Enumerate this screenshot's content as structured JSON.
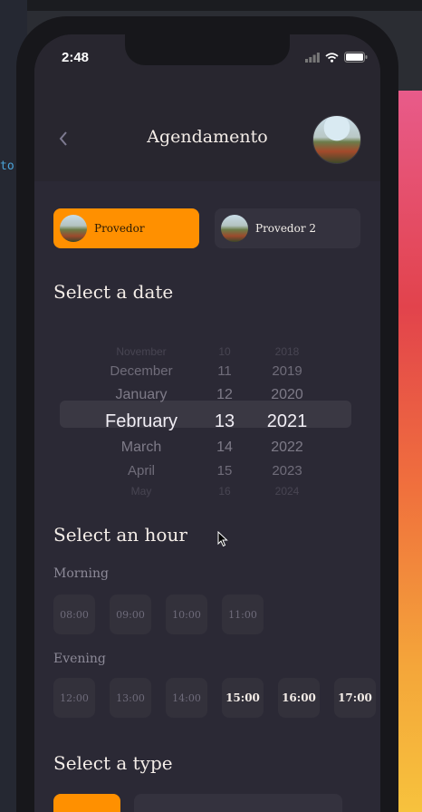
{
  "status": {
    "time": "2:48"
  },
  "header": {
    "title": "Agendamento",
    "back_icon": "chevron-left-icon"
  },
  "providers": [
    {
      "label": "Provedor",
      "selected": true
    },
    {
      "label": "Provedor 2",
      "selected": false
    }
  ],
  "date_section": {
    "title": "Select a date"
  },
  "date_picker": {
    "months": [
      "November",
      "December",
      "January",
      "February",
      "March",
      "April",
      "May"
    ],
    "days": [
      "10",
      "11",
      "12",
      "13",
      "14",
      "15",
      "16"
    ],
    "years": [
      "2018",
      "2019",
      "2020",
      "2021",
      "2022",
      "2023",
      "2024"
    ],
    "selected": {
      "month": "February",
      "day": "13",
      "year": "2021"
    }
  },
  "hour_section": {
    "title": "Select an hour",
    "morning_label": "Morning",
    "morning": [
      {
        "label": "08:00",
        "available": false
      },
      {
        "label": "09:00",
        "available": false
      },
      {
        "label": "10:00",
        "available": false
      },
      {
        "label": "11:00",
        "available": false
      }
    ],
    "evening_label": "Evening",
    "evening": [
      {
        "label": "12:00",
        "available": false
      },
      {
        "label": "13:00",
        "available": false
      },
      {
        "label": "14:00",
        "available": false
      },
      {
        "label": "15:00",
        "available": true
      },
      {
        "label": "16:00",
        "available": true
      },
      {
        "label": "17:00",
        "available": true
      }
    ]
  },
  "type_section": {
    "title": "Select a type"
  },
  "colors": {
    "accent": "#ff9000",
    "background": "#2b2935",
    "card": "#34323e"
  }
}
